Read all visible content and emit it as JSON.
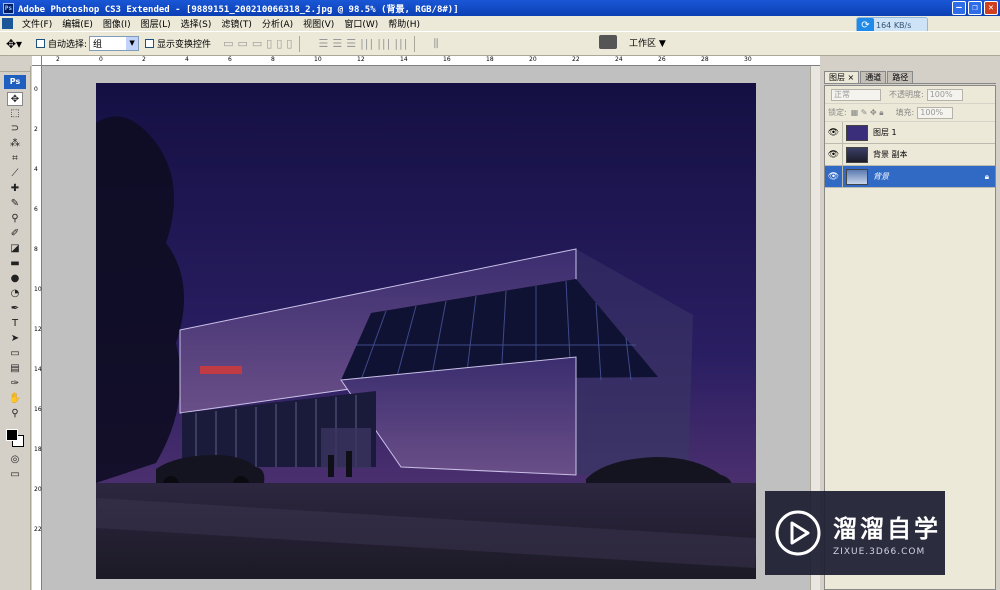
{
  "window": {
    "title": "Adobe Photoshop CS3 Extended - [9889151_200210066318_2.jpg @ 98.5% (背景, RGB/8#)]"
  },
  "menu": [
    "文件(F)",
    "编辑(E)",
    "图像(I)",
    "图层(L)",
    "选择(S)",
    "滤镜(T)",
    "分析(A)",
    "视图(V)",
    "窗口(W)",
    "帮助(H)"
  ],
  "speed": "164 KB/s",
  "options": {
    "auto_select_label": "自动选择:",
    "auto_select_value": "组",
    "show_transform_label": "显示变换控件",
    "workspace_label": "工作区"
  },
  "toolbox": {
    "logo": "Ps",
    "tools": [
      "move-tool",
      "marquee-tool",
      "lasso-tool",
      "magic-wand-tool",
      "crop-tool",
      "slice-tool",
      "healing-brush-tool",
      "brush-tool",
      "clone-stamp-tool",
      "history-brush-tool",
      "eraser-tool",
      "gradient-tool",
      "blur-tool",
      "dodge-tool",
      "pen-tool",
      "type-tool",
      "path-selection-tool",
      "shape-tool",
      "notes-tool",
      "eyedropper-tool",
      "hand-tool",
      "zoom-tool"
    ]
  },
  "rulers": {
    "h": [
      "2",
      "0",
      "2",
      "4",
      "6",
      "8",
      "10",
      "12",
      "14",
      "16",
      "18",
      "20",
      "22",
      "24",
      "26",
      "28",
      "30"
    ],
    "v": [
      "0",
      "2",
      "4",
      "6",
      "8",
      "10",
      "12",
      "14",
      "16",
      "18",
      "20",
      "22"
    ]
  },
  "layers_panel": {
    "tabs": [
      "图层",
      "通道",
      "路径"
    ],
    "blend_mode": "正常",
    "opacity_label": "不透明度:",
    "opacity_value": "100%",
    "lock_label": "锁定:",
    "fill_label": "填充:",
    "fill_value": "100%",
    "layers": [
      {
        "name": "图层 1",
        "active": false
      },
      {
        "name": "背景 副本",
        "active": false
      },
      {
        "name": "背景",
        "active": true
      }
    ]
  },
  "watermark": {
    "title": "溜溜自学",
    "subtitle": "ZIXUE.3D66.COM"
  },
  "colors": {
    "titlebar": "#0b3fb4",
    "canvas_sky": "#1d1850",
    "active_layer": "#316ac5"
  }
}
